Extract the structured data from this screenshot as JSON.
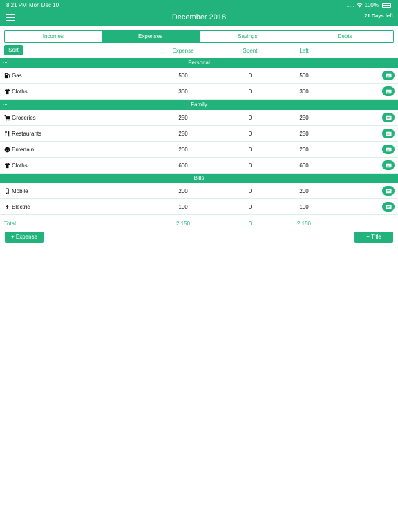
{
  "status_bar": {
    "time": "8:21 PM",
    "date": "Mon Dec 10",
    "signal_dots": ".....",
    "battery": "100%"
  },
  "header": {
    "title": "December 2018",
    "days_left": "21 Days left"
  },
  "tabs": [
    {
      "label": "Incomes",
      "active": false
    },
    {
      "label": "Expenses",
      "active": true
    },
    {
      "label": "Savings",
      "active": false
    },
    {
      "label": "Debts",
      "active": false
    }
  ],
  "toolbar": {
    "sort_label": "Sort"
  },
  "columns": {
    "expense": "Expense",
    "spent": "Spent",
    "left": "Left"
  },
  "sections": [
    {
      "title": "Personal",
      "collapse_glyph": "...",
      "rows": [
        {
          "icon": "fuel-icon",
          "name": "Gas",
          "expense": "500",
          "spent": "0",
          "left": "500"
        },
        {
          "icon": "shirt-icon",
          "name": "Cloths",
          "expense": "300",
          "spent": "0",
          "left": "300"
        }
      ]
    },
    {
      "title": "Family",
      "collapse_glyph": "...",
      "rows": [
        {
          "icon": "cart-icon",
          "name": "Groceries",
          "expense": "250",
          "spent": "0",
          "left": "250"
        },
        {
          "icon": "utensils-icon",
          "name": "Restaurants",
          "expense": "250",
          "spent": "0",
          "left": "250"
        },
        {
          "icon": "smile-icon",
          "name": "Entertain",
          "expense": "200",
          "spent": "0",
          "left": "200"
        },
        {
          "icon": "shirt-icon",
          "name": "Cloths",
          "expense": "600",
          "spent": "0",
          "left": "600"
        }
      ]
    },
    {
      "title": "Bills",
      "collapse_glyph": "...",
      "rows": [
        {
          "icon": "mobile-icon",
          "name": "Mobile",
          "expense": "200",
          "spent": "0",
          "left": "200"
        },
        {
          "icon": "bolt-icon",
          "name": "Electric",
          "expense": "100",
          "spent": "0",
          "left": "100"
        }
      ]
    }
  ],
  "total": {
    "label": "Total",
    "expense": "2,150",
    "spent": "0",
    "left": "2,150"
  },
  "footer": {
    "add_expense": "+ Expense",
    "add_title": "+ Title"
  },
  "colors": {
    "accent": "#22b27b"
  }
}
